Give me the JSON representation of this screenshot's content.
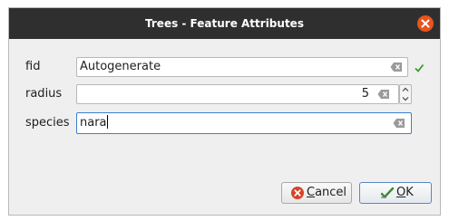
{
  "window": {
    "title": "Trees - Feature Attributes"
  },
  "form": {
    "fields": [
      {
        "label": "fid",
        "value": "Autogenerate"
      },
      {
        "label": "radius",
        "value": "5"
      },
      {
        "label": "species",
        "value": "nara"
      }
    ]
  },
  "buttons": {
    "cancel": {
      "mnemonic": "C",
      "rest": "ancel"
    },
    "ok": {
      "mnemonic": "O",
      "rest": "K"
    }
  },
  "colors": {
    "titlebar": "#2f2f2f",
    "close": "#e9541e",
    "focus": "#3d7fd1",
    "check": "#3c9a2e",
    "cancel_icon": "#d6452a",
    "ok_icon": "#3c8a2e"
  },
  "icons": {
    "close": "close-icon",
    "clear": "clear-icon",
    "valid": "checkmark-icon",
    "spin_up": "chevron-up-icon",
    "spin_down": "chevron-down-icon",
    "cancel": "cancel-icon",
    "ok": "ok-icon"
  }
}
